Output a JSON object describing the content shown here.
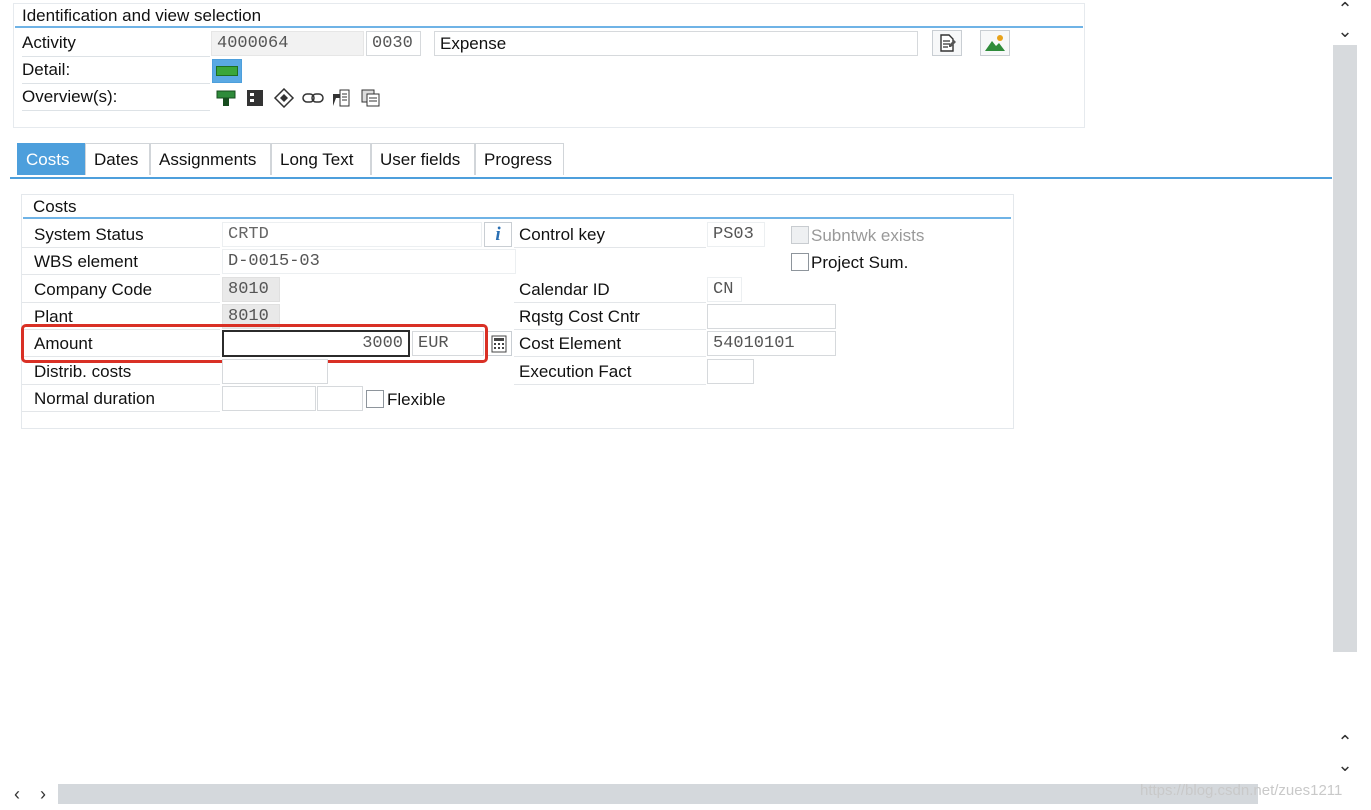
{
  "identification": {
    "title": "Identification and view selection",
    "activity_label": "Activity",
    "activity_number": "4000064",
    "activity_subnumber": "0030",
    "activity_description": "Expense",
    "detail_label": "Detail:",
    "overviews_label": "Overview(s):"
  },
  "tabs": [
    {
      "label": "Costs",
      "active": true
    },
    {
      "label": "Dates"
    },
    {
      "label": "Assignments"
    },
    {
      "label": "Long Text"
    },
    {
      "label": "User fields"
    },
    {
      "label": "Progress"
    }
  ],
  "costs": {
    "title": "Costs",
    "system_status_label": "System Status",
    "system_status_value": "CRTD",
    "wbs_label": "WBS element",
    "wbs_value": "D-0015-03",
    "company_code_label": "Company Code",
    "company_code_value": "8010",
    "plant_label": "Plant",
    "plant_value": "8010",
    "amount_label": "Amount",
    "amount_value": "3000",
    "currency": "EUR",
    "distrib_costs_label": "Distrib. costs",
    "normal_duration_label": "Normal duration",
    "flexible_label": "Flexible",
    "control_key_label": "Control key",
    "control_key_value": "PS03",
    "subntwk_label": "Subntwk exists",
    "project_sum_label": "Project Sum.",
    "calendar_id_label": "Calendar ID",
    "calendar_id_value": "CN",
    "rqstg_cost_cntr_label": "Rqstg Cost Cntr",
    "cost_element_label": "Cost Element",
    "cost_element_value": "54010101",
    "execution_fact_label": "Execution Fact"
  },
  "highlight_color": "#d93025",
  "accent_color": "#4d9fdc",
  "watermark": "https://blog.csdn.net/zues1211"
}
